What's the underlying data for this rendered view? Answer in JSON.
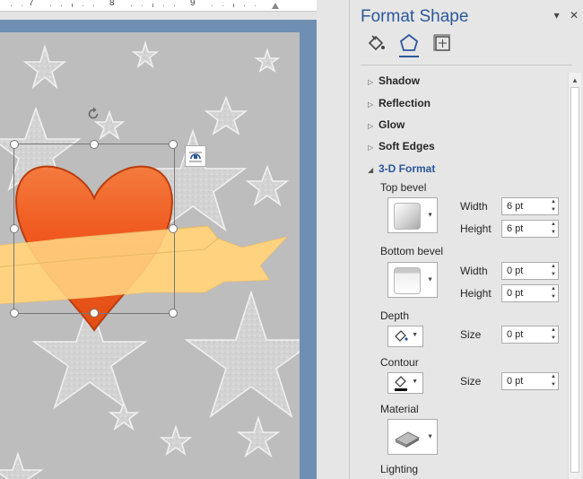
{
  "ruler": {
    "marks": [
      "7",
      "8",
      "9"
    ]
  },
  "pane": {
    "title": "Format Shape",
    "controls": {
      "dropdown": "▾",
      "close": "✕"
    },
    "tabs": [
      {
        "icon": "fill-line-icon"
      },
      {
        "icon": "effects-pentagon-icon"
      },
      {
        "icon": "size-properties-icon"
      }
    ],
    "sections": {
      "shadow": "Shadow",
      "reflection": "Reflection",
      "glow": "Glow",
      "soft_edges": "Soft Edges",
      "format_3d": "3-D Format"
    },
    "format3d": {
      "top_bevel": "Top bevel",
      "bottom_bevel": "Bottom bevel",
      "depth": "Depth",
      "contour": "Contour",
      "material": "Material",
      "lighting": "Lighting",
      "width_label": "Width",
      "height_label": "Height",
      "size_label": "Size",
      "top_width": "6 pt",
      "top_height": "6 pt",
      "bottom_width": "0 pt",
      "bottom_height": "0 pt",
      "depth_size": "0 pt",
      "contour_size": "0 pt"
    }
  },
  "colors": {
    "accent": "#2b579a",
    "heart": "#f05a20",
    "banner": "#ffd27f",
    "page_border": "#6e8fb3"
  }
}
